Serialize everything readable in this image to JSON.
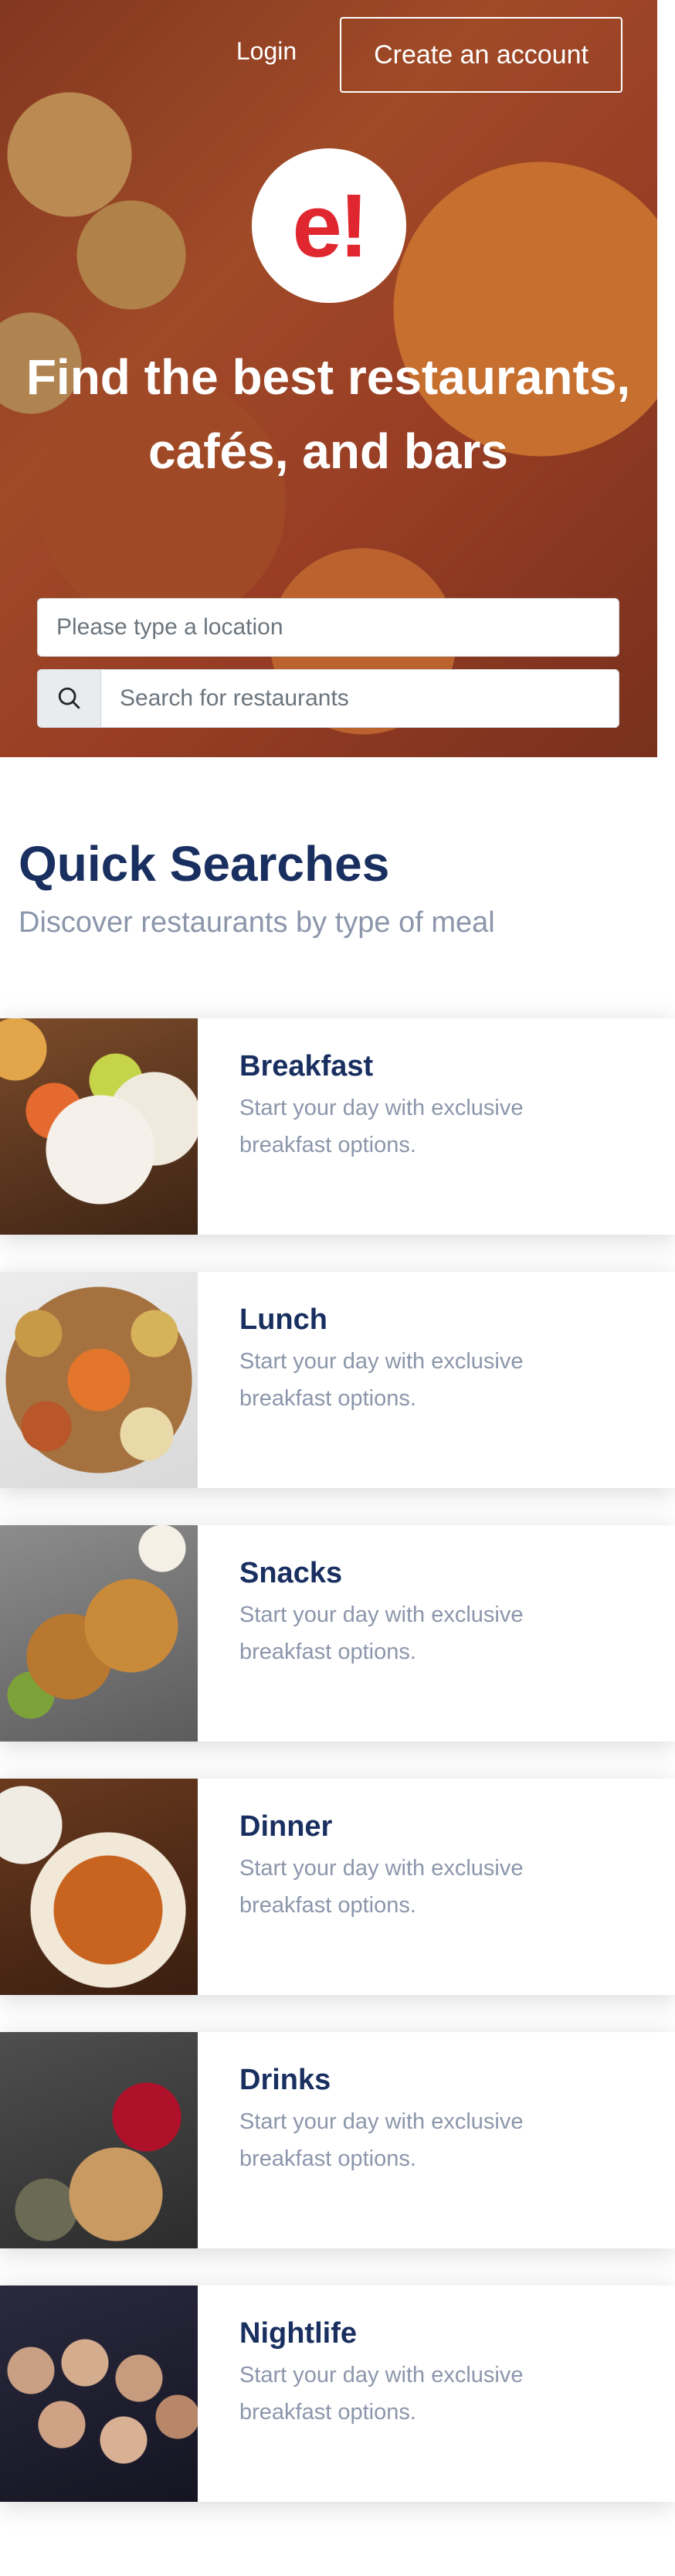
{
  "header": {
    "login_label": "Login",
    "create_account_label": "Create an account"
  },
  "hero": {
    "logo_text": "e!",
    "title": "Find the best restaurants, cafés, and bars",
    "location_placeholder": "Please type a location",
    "restaurant_placeholder": "Search for restaurants",
    "search_icon": "search-icon"
  },
  "quick_searches": {
    "heading": "Quick Searches",
    "subheading": "Discover restaurants by type of meal",
    "items": [
      {
        "title": "Breakfast",
        "description": "Start your day with exclusive breakfast options."
      },
      {
        "title": "Lunch",
        "description": "Start your day with exclusive breakfast options."
      },
      {
        "title": "Snacks",
        "description": "Start your day with exclusive breakfast options."
      },
      {
        "title": "Dinner",
        "description": "Start your day with exclusive breakfast options."
      },
      {
        "title": "Drinks",
        "description": "Start your day with exclusive breakfast options."
      },
      {
        "title": "Nightlife",
        "description": "Start your day with exclusive breakfast options."
      }
    ]
  },
  "colors": {
    "brand_red": "#e0272f",
    "heading_navy": "#192f60",
    "muted_text": "#8c96ab"
  }
}
